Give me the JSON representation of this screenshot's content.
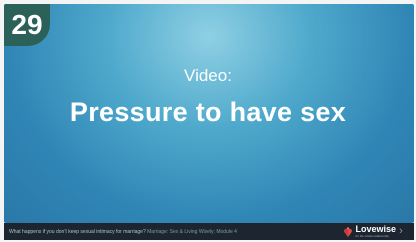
{
  "slide": {
    "number": "29",
    "subtitle": "Video:",
    "title": "Pressure to have sex"
  },
  "footer": {
    "caption_question": "What happens if you don’t keep sexual intimacy for marriage?",
    "caption_source": "Marriage: Sex & Living Wisely; Module 4",
    "brand_name": "Lovewise",
    "brand_tagline": "for the whole relationship",
    "next_glyph": "›"
  },
  "colors": {
    "slide_gradient_center": "#8fd0e3",
    "slide_gradient_edge": "#2a78a8",
    "slide_number_badge": "#2b6159",
    "footer_bar": "#1d2630"
  }
}
